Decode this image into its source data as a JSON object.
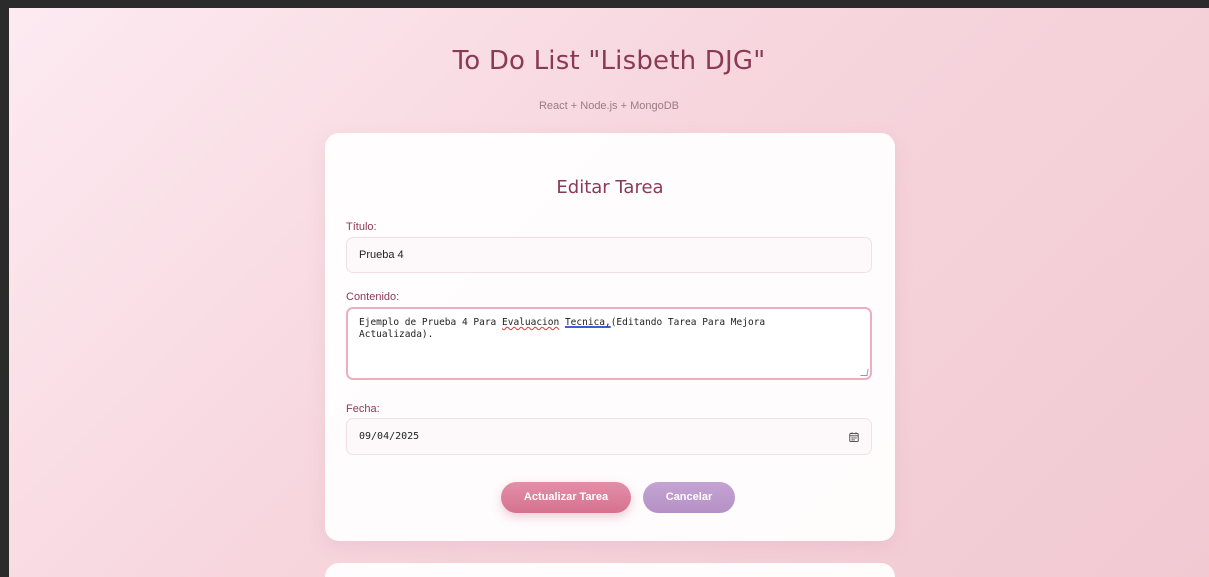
{
  "header": {
    "title": "To Do List \"Lisbeth DJG\"",
    "subtitle": "React + Node.js + MongoDB"
  },
  "edit_form": {
    "heading": "Editar Tarea",
    "title_label": "Título:",
    "title_value": "Prueba 4",
    "content_label": "Contenido:",
    "content_value": {
      "part1": "Ejemplo de Prueba 4 Para ",
      "misspelled": "Evaluacion",
      "part2": " ",
      "grammar": "Tecnica,",
      "part3": "(Editando Tarea Para Mejora",
      "line2": "Actualizada)."
    },
    "date_label": "Fecha:",
    "date_value": "09/04/2025",
    "date_icon": "calendar-icon",
    "update_button": "Actualizar Tarea",
    "cancel_button": "Cancelar"
  },
  "colors": {
    "accent": "#8a3a56",
    "update_button": "#d5728f",
    "cancel_button": "#b591c5",
    "background": "#f7d6de"
  }
}
